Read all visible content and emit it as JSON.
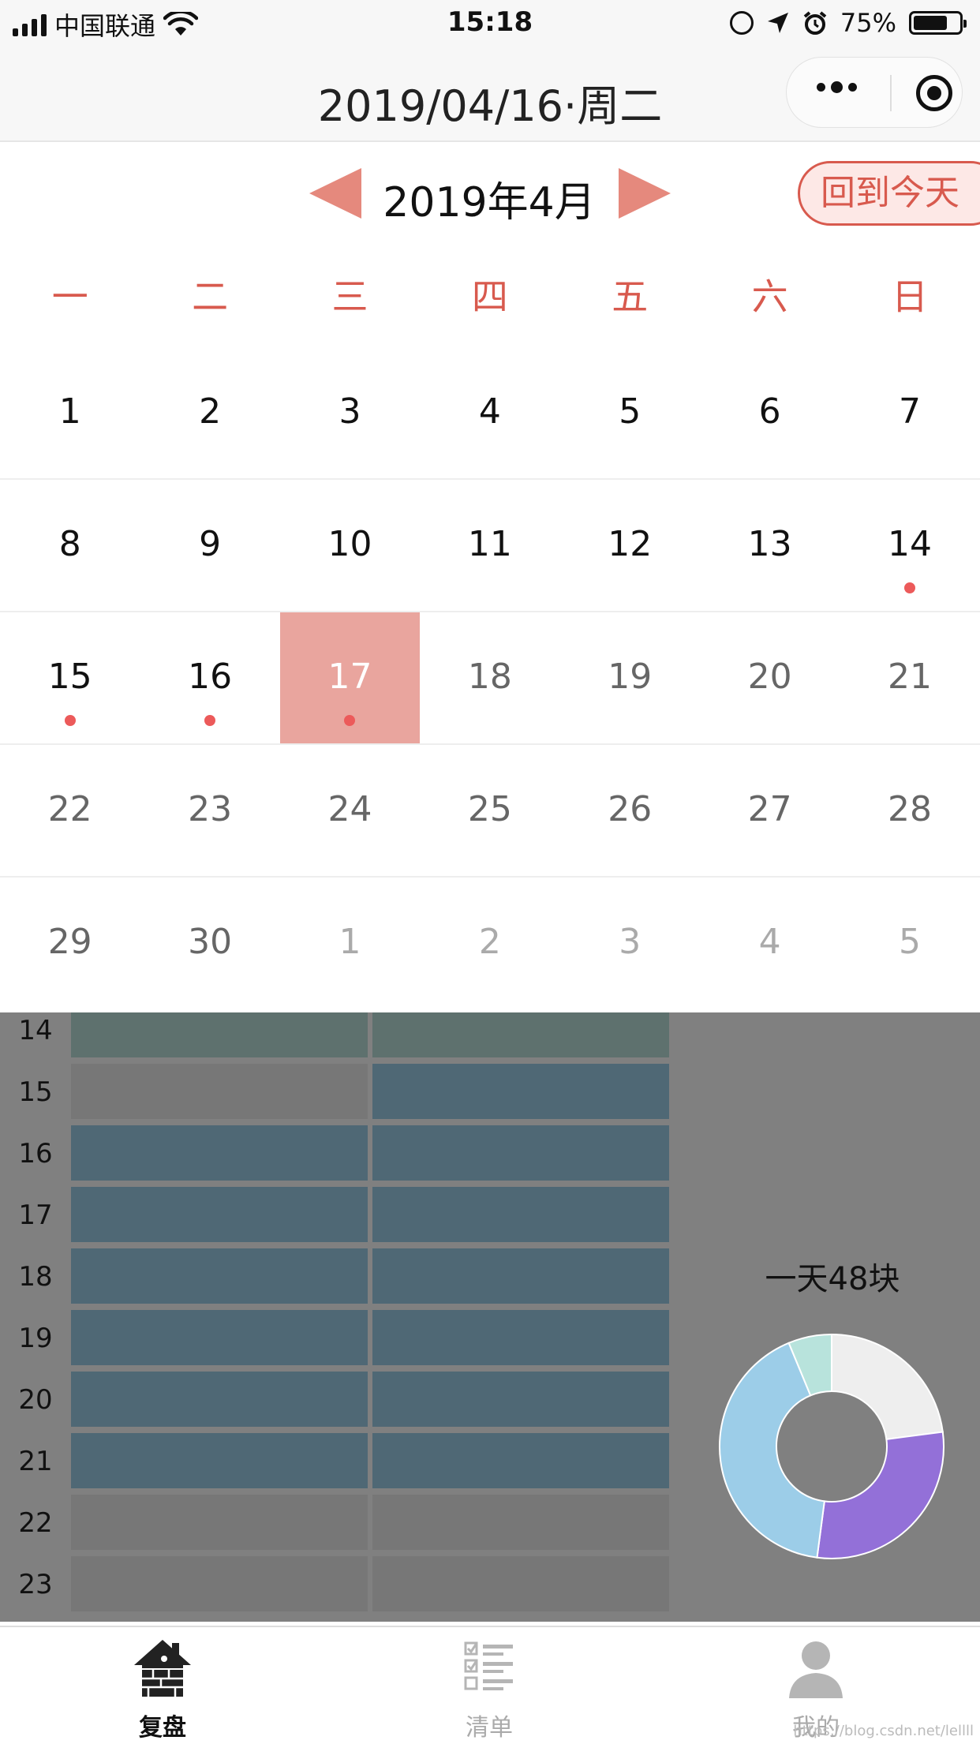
{
  "status_bar": {
    "carrier": "中国联通",
    "time": "15:18",
    "battery": "75%",
    "battery_level": 0.75
  },
  "navbar": {
    "title": "2019/04/16·周二"
  },
  "calendar": {
    "month_label": "2019年4月",
    "today_button": "回到今天",
    "weekdays": [
      "一",
      "二",
      "三",
      "四",
      "五",
      "六",
      "日"
    ],
    "weeks": [
      [
        {
          "n": "1",
          "s": "past"
        },
        {
          "n": "2",
          "s": "past"
        },
        {
          "n": "3",
          "s": "past"
        },
        {
          "n": "4",
          "s": "past"
        },
        {
          "n": "5",
          "s": "past"
        },
        {
          "n": "6",
          "s": "past"
        },
        {
          "n": "7",
          "s": "past"
        }
      ],
      [
        {
          "n": "8",
          "s": "past"
        },
        {
          "n": "9",
          "s": "past"
        },
        {
          "n": "10",
          "s": "past"
        },
        {
          "n": "11",
          "s": "past"
        },
        {
          "n": "12",
          "s": "past"
        },
        {
          "n": "13",
          "s": "past"
        },
        {
          "n": "14",
          "s": "past",
          "dot": true
        }
      ],
      [
        {
          "n": "15",
          "s": "past",
          "dot": true
        },
        {
          "n": "16",
          "s": "past",
          "dot": true
        },
        {
          "n": "17",
          "s": "selected",
          "dot": true
        },
        {
          "n": "18",
          "s": "future"
        },
        {
          "n": "19",
          "s": "future"
        },
        {
          "n": "20",
          "s": "future"
        },
        {
          "n": "21",
          "s": "future"
        }
      ],
      [
        {
          "n": "22",
          "s": "future"
        },
        {
          "n": "23",
          "s": "future"
        },
        {
          "n": "24",
          "s": "future"
        },
        {
          "n": "25",
          "s": "future"
        },
        {
          "n": "26",
          "s": "future"
        },
        {
          "n": "27",
          "s": "future"
        },
        {
          "n": "28",
          "s": "future"
        }
      ],
      [
        {
          "n": "29",
          "s": "future"
        },
        {
          "n": "30",
          "s": "future"
        },
        {
          "n": "1",
          "s": "other"
        },
        {
          "n": "2",
          "s": "other"
        },
        {
          "n": "3",
          "s": "other"
        },
        {
          "n": "4",
          "s": "other"
        },
        {
          "n": "5",
          "s": "other"
        }
      ]
    ]
  },
  "schedule": {
    "hours": [
      "14",
      "15",
      "16",
      "17",
      "18",
      "19",
      "20",
      "21",
      "22",
      "23"
    ],
    "rows": [
      [
        "green",
        "green"
      ],
      [
        "grey",
        "blue"
      ],
      [
        "blue",
        "blue"
      ],
      [
        "blue",
        "blue"
      ],
      [
        "blue",
        "blue"
      ],
      [
        "blue",
        "blue"
      ],
      [
        "blue",
        "blue"
      ],
      [
        "blue",
        "blue"
      ],
      [
        "grey",
        "grey"
      ],
      [
        "grey",
        "grey"
      ]
    ],
    "colors": {
      "green": "#5e716e",
      "blue": "#4f6875",
      "grey": "#777777"
    }
  },
  "summary": {
    "label": "一天48块",
    "donut_segments": [
      {
        "value": 11,
        "color": "#eeeeee"
      },
      {
        "value": 14,
        "color": "#9370d8"
      },
      {
        "value": 20,
        "color": "#9ccde8"
      },
      {
        "value": 3,
        "color": "#b8e3dc"
      }
    ]
  },
  "tabbar": {
    "tabs": [
      {
        "label": "复盘",
        "icon": "house-icon",
        "active": true
      },
      {
        "label": "清单",
        "icon": "checklist-icon",
        "active": false
      },
      {
        "label": "我的",
        "icon": "person-icon",
        "active": false
      }
    ]
  },
  "watermark": "https://blog.csdn.net/lellll"
}
